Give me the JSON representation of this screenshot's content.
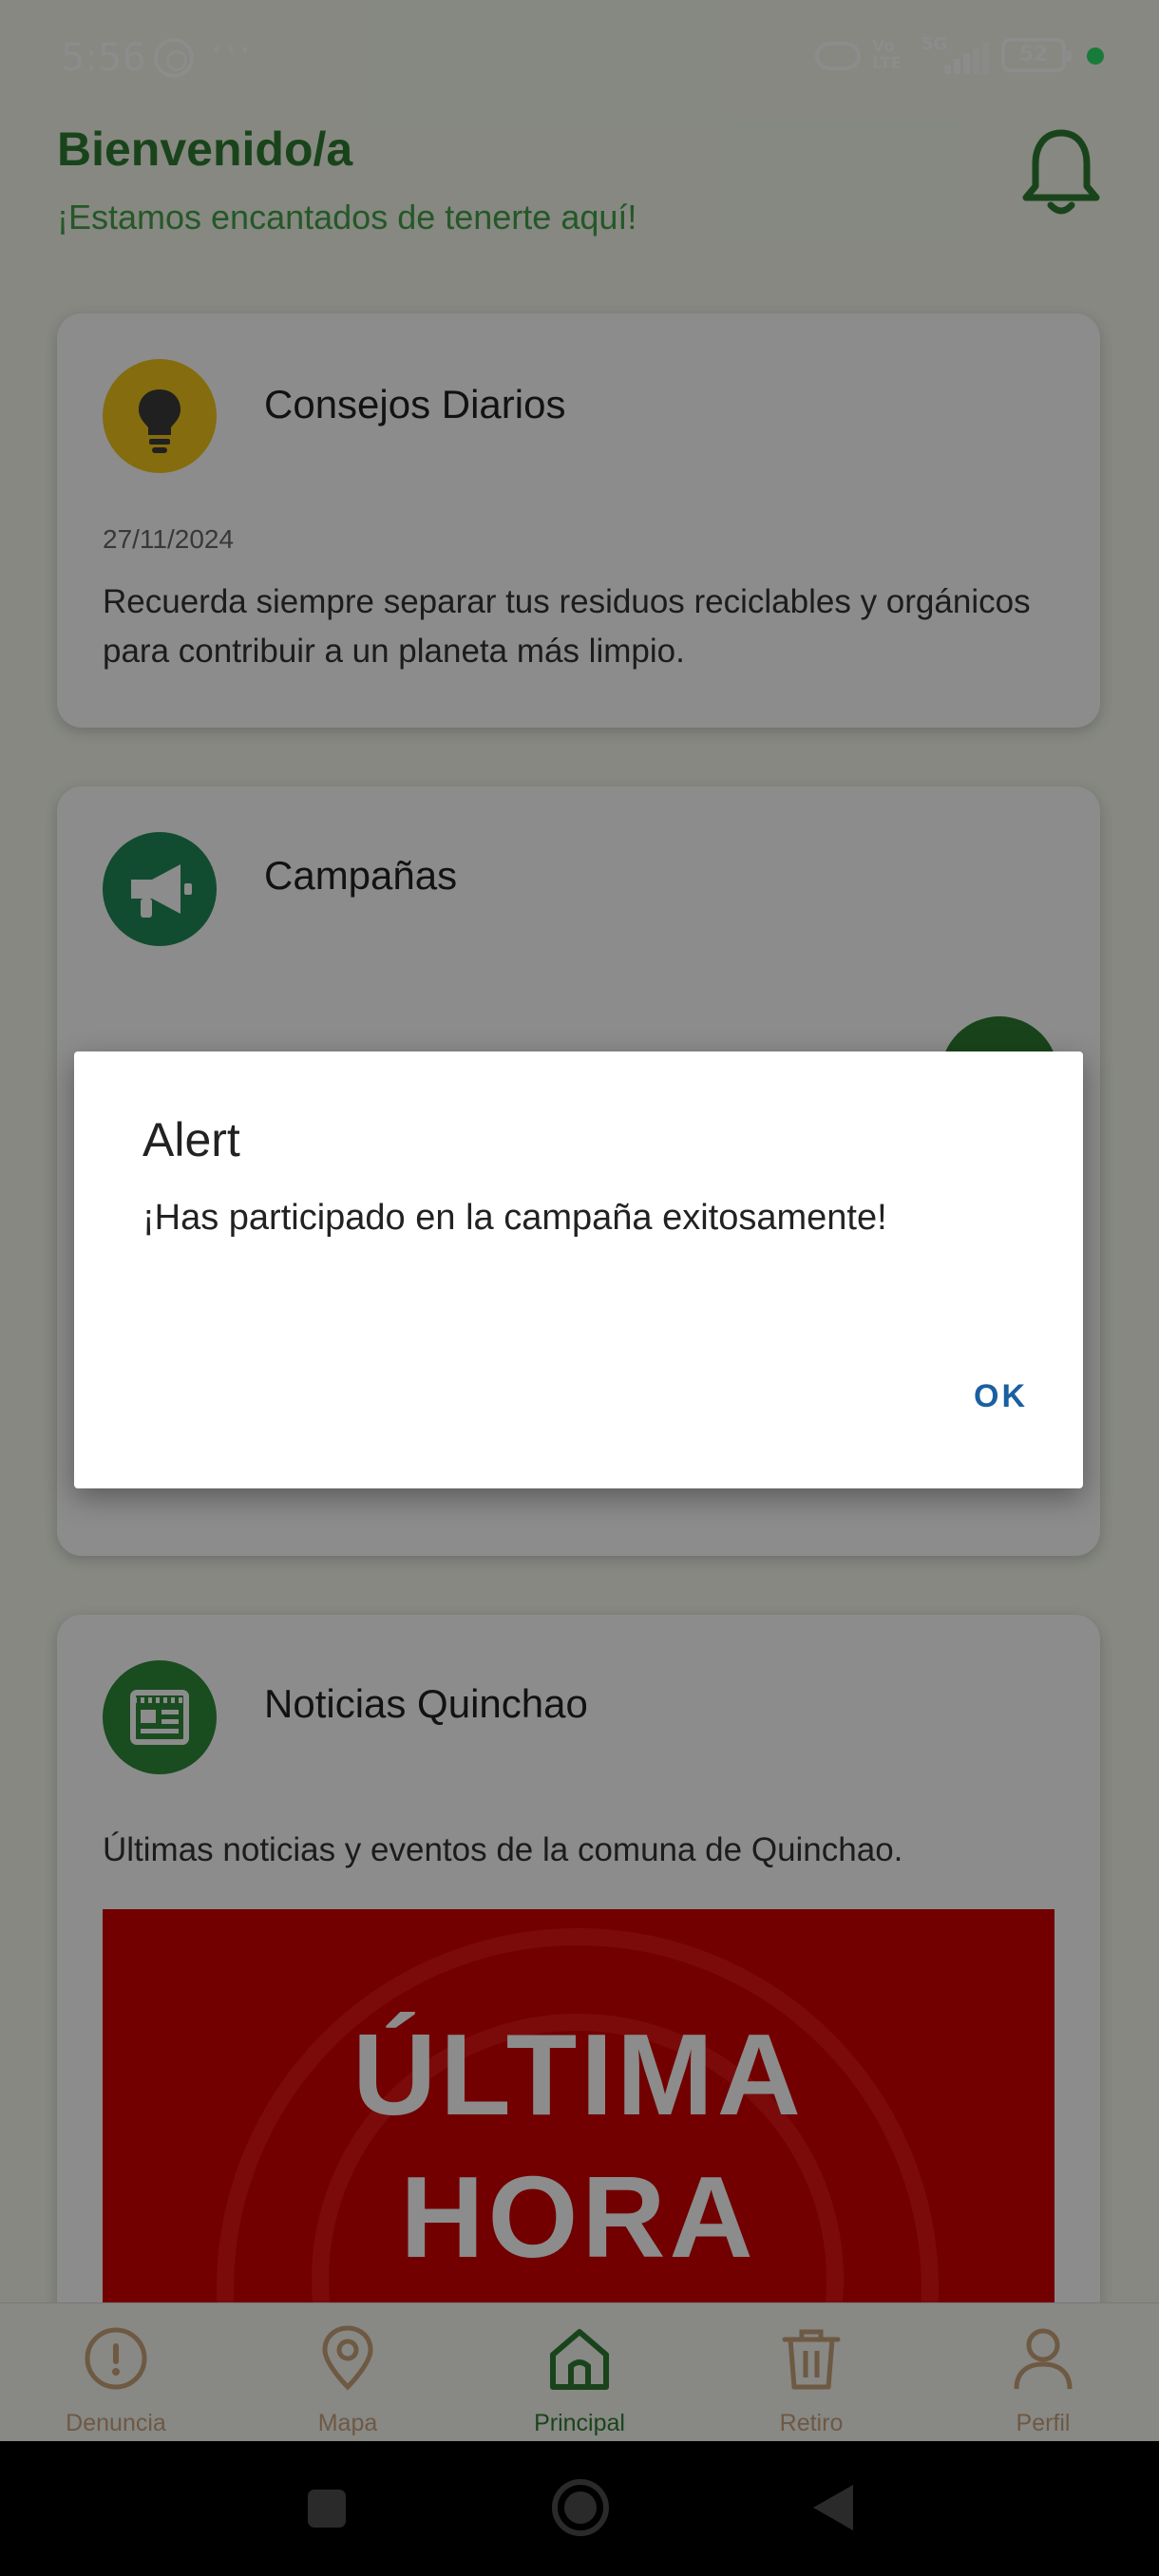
{
  "status_bar": {
    "time": "5:56",
    "dots": "···",
    "volte": "Vo LTE",
    "network": "5G",
    "battery": "52"
  },
  "header": {
    "title": "Bienvenido/a",
    "subtitle": "¡Estamos encantados de tenerte aquí!"
  },
  "cards": {
    "tips": {
      "title": "Consejos Diarios",
      "date": "27/11/2024",
      "text": "Recuerda siempre separar tus residuos reciclables y orgánicos para contribuir a un planeta más limpio.",
      "icon": "lightbulb-icon",
      "color": "#f2c51a"
    },
    "campaigns": {
      "title": "Campañas",
      "icon": "megaphone-icon",
      "color": "#1f8a58"
    },
    "news": {
      "title": "Noticias Quinchao",
      "text": "Últimas noticias y eventos de la comuna de Quinchao.",
      "banner_line1": "ÚLTIMA",
      "banner_line2": "HORA",
      "icon": "newspaper-icon",
      "color": "#2e8b3a"
    }
  },
  "bottom_nav": {
    "items": [
      {
        "label": "Denuncia",
        "icon": "alert-circle-icon"
      },
      {
        "label": "Mapa",
        "icon": "map-pin-icon"
      },
      {
        "label": "Principal",
        "icon": "home-icon"
      },
      {
        "label": "Retiro",
        "icon": "trash-icon"
      },
      {
        "label": "Perfil",
        "icon": "user-icon"
      }
    ],
    "active_index": 2,
    "active_color": "#2e7d32",
    "inactive_color": "#c8a27a"
  },
  "dialog": {
    "title": "Alert",
    "message": "¡Has participado en la campaña exitosamente!",
    "ok_label": "OK"
  }
}
